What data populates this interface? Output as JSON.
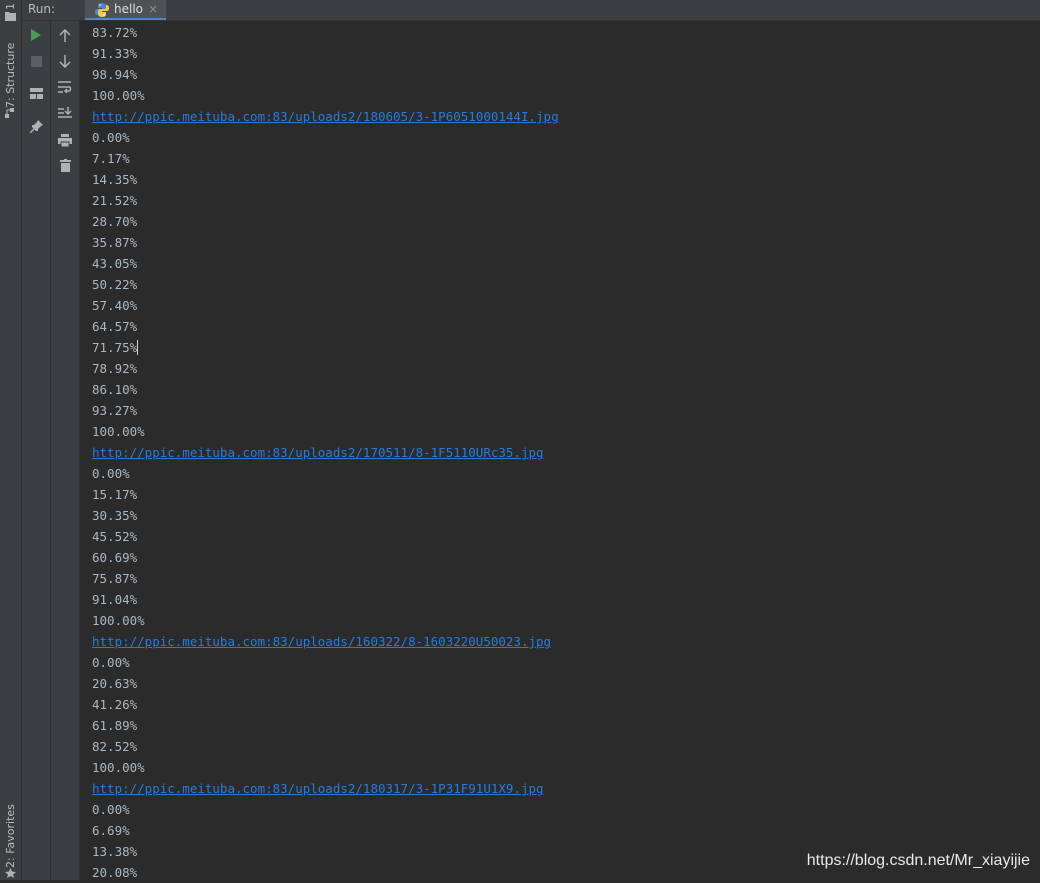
{
  "run_panel": {
    "label": "Run:",
    "tab": {
      "name": "hello",
      "icon": "python-icon"
    }
  },
  "side_tabs": {
    "project": "1",
    "structure": "7: Structure",
    "favorites": "2: Favorites"
  },
  "toolbar": {
    "run": "run-icon",
    "stop": "stop-icon",
    "layout": "layout-icon",
    "pin": "pin-icon",
    "up": "arrow-up-icon",
    "down": "arrow-down-icon",
    "wrap": "soft-wrap-icon",
    "scroll_end": "scroll-to-end-icon",
    "print": "print-icon",
    "clear": "trash-icon"
  },
  "console": {
    "lines": [
      "83.72%",
      "91.33%",
      "98.94%",
      "100.00%",
      "http://ppic.meituba.com:83/uploads2/180605/3-1P6051000144I.jpg",
      "0.00%",
      "7.17%",
      "14.35%",
      "21.52%",
      "28.70%",
      "35.87%",
      "43.05%",
      "50.22%",
      "57.40%",
      "64.57%",
      "71.75%",
      "78.92%",
      "86.10%",
      "93.27%",
      "100.00%",
      "http://ppic.meituba.com:83/uploads2/170511/8-1F5110URc35.jpg",
      "0.00%",
      "15.17%",
      "30.35%",
      "45.52%",
      "60.69%",
      "75.87%",
      "91.04%",
      "100.00%",
      "http://ppic.meituba.com:83/uploads/160322/8-1603220U50023.jpg",
      "0.00%",
      "20.63%",
      "41.26%",
      "61.89%",
      "82.52%",
      "100.00%",
      "http://ppic.meituba.com:83/uploads2/180317/3-1P31F91U1X9.jpg",
      "0.00%",
      "6.69%",
      "13.38%",
      "20.08%"
    ]
  },
  "watermark": "https://blog.csdn.net/Mr_xiayijie",
  "colors": {
    "link": "#287bde",
    "text": "#a9b7c6",
    "background": "#2b2b2b",
    "panel": "#3c3f41",
    "run_green": "#499c54"
  }
}
